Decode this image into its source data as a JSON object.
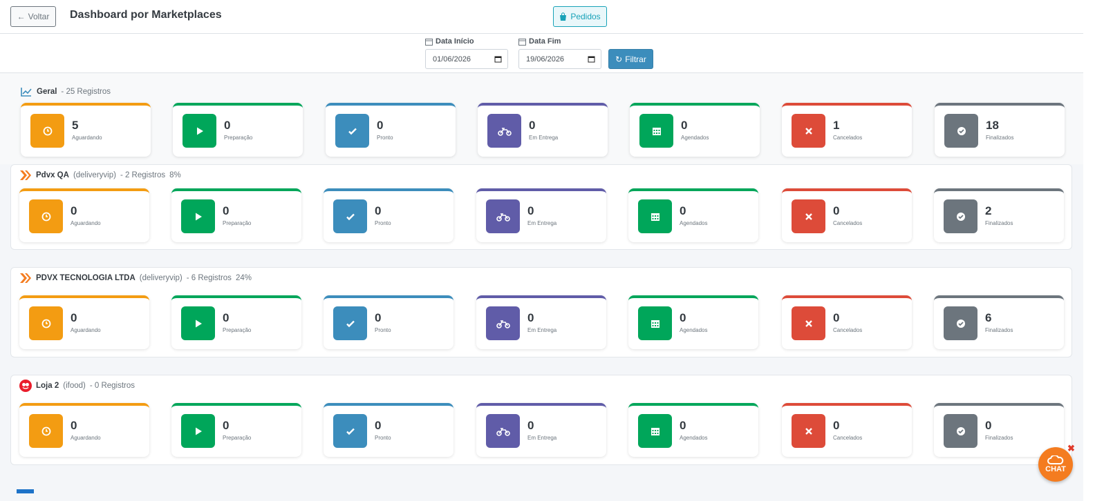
{
  "header": {
    "back_label": "Voltar",
    "title": "Dashboard por Marketplaces",
    "pedidos_label": "Pedidos"
  },
  "filters": {
    "start_label": "Data Início",
    "start_value": "01/06/2026",
    "end_label": "Data Fim",
    "end_value": "19/06/2026",
    "filter_label": "Filtrar"
  },
  "status_labels": [
    "Aguardando",
    "Preparação",
    "Pronto",
    "Em Entrega",
    "Agendados",
    "Cancelados",
    "Finalizados"
  ],
  "status_icons": [
    "clock-icon",
    "play-icon",
    "check-icon",
    "motorcycle-icon",
    "calendar-icon",
    "x-icon",
    "check-circle-icon"
  ],
  "status_colors": [
    "#f39c12",
    "#00a65a",
    "#3c8dbc",
    "#605ca8",
    "#00a65a",
    "#dd4b39",
    "#6c757d"
  ],
  "sections": [
    {
      "name": "Geral",
      "source": "",
      "count_text": "- 25 Registros",
      "percent": "",
      "logo": "chart-line-icon",
      "values": [
        "5",
        "0",
        "0",
        "0",
        "0",
        "1",
        "18"
      ]
    },
    {
      "name": "Pdvx QA",
      "source": "(deliveryvip)",
      "count_text": "- 2 Registros",
      "percent": "8%",
      "logo": "deliveryvip-logo-icon",
      "values": [
        "0",
        "0",
        "0",
        "0",
        "0",
        "0",
        "2"
      ]
    },
    {
      "name": "PDVX TECNOLOGIA LTDA",
      "source": "(deliveryvip)",
      "count_text": "- 6 Registros",
      "percent": "24%",
      "logo": "deliveryvip-logo-icon",
      "values": [
        "0",
        "0",
        "0",
        "0",
        "0",
        "0",
        "6"
      ]
    },
    {
      "name": "Loja 2",
      "source": "(ifood)",
      "count_text": "- 0 Registros",
      "percent": "",
      "logo": "ifood-logo-icon",
      "values": [
        "0",
        "0",
        "0",
        "0",
        "0",
        "0",
        "0"
      ]
    }
  ],
  "chat": {
    "label": "CHAT"
  }
}
